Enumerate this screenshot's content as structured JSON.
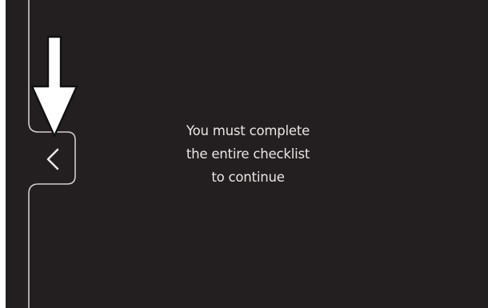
{
  "message": {
    "line1": "You must complete",
    "line2": "the entire checklist",
    "line3": "to continue"
  },
  "back_tab": {
    "icon": "chevron-left-icon"
  },
  "annotation": {
    "icon": "down-arrow-icon"
  },
  "colors": {
    "background": "#231f20",
    "text": "#e8e6e4",
    "rail": "#cfcdcb",
    "frame": "#ffffff"
  }
}
